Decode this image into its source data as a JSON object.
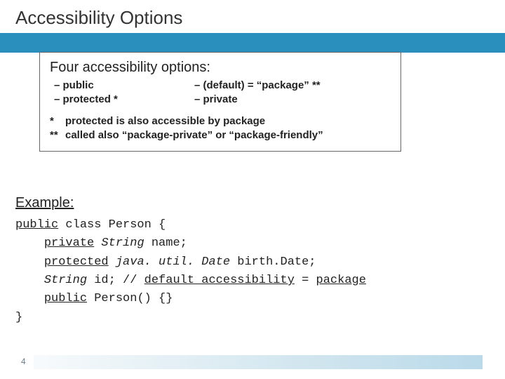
{
  "title": "Accessibility Options",
  "box": {
    "heading": "Four accessibility options:",
    "left": {
      "a": "public",
      "b": "protected *"
    },
    "right": {
      "a": "(default) = “package” **",
      "b": "private"
    },
    "fn1": {
      "mark": "*",
      "text": "protected is also accessible by package"
    },
    "fn2": {
      "mark": "**",
      "text": "called also “package-private” or “package-friendly”"
    }
  },
  "example_label": "Example:",
  "code": {
    "l1a": "public",
    "l1b": " class Person {",
    "l2a": "private",
    "l2b": " String",
    "l2c": " name;",
    "l3a": "protected",
    "l3b": " java. util. Date",
    "l3c": " birth.Date;",
    "l4a": "String",
    "l4b": " id; // ",
    "l4c": "default accessibility",
    "l4d": " = ",
    "l4e": "package",
    "l5a": "public",
    "l5b": " Person() {}",
    "l6": "}"
  },
  "page_number": "4"
}
